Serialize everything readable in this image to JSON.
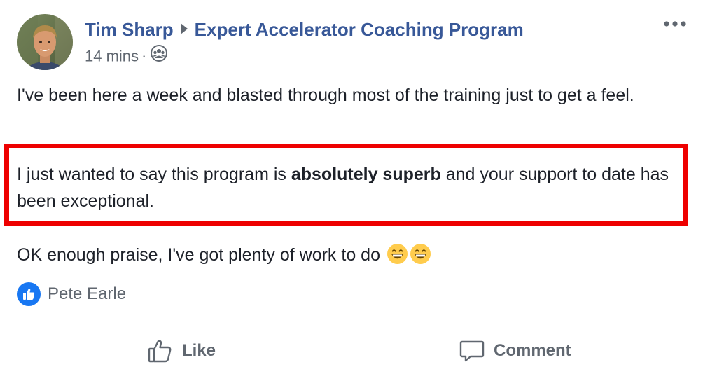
{
  "post": {
    "author": "Tim Sharp",
    "group": "Expert Accelerator Coaching Program",
    "time": "14 mins",
    "separator": "·",
    "audience_icon": "group-icon",
    "more_icon": "more-options-icon",
    "paragraph1": "I've been here a week and blasted through most of the training just to get a feel.",
    "paragraph2_before": "I just wanted to say this program is ",
    "paragraph2_bold": "absolutely superb",
    "paragraph2_after": " and your support to date has been exceptional.",
    "paragraph3": "OK enough praise, I've got plenty of work to do",
    "emojis": [
      "grinning-face-emoji",
      "grinning-face-emoji"
    ],
    "highlight_color": "#ee0000"
  },
  "reactions": {
    "icon": "like-icon",
    "names": "Pete Earle"
  },
  "actions": {
    "like_label": "Like",
    "comment_label": "Comment"
  },
  "colors": {
    "link": "#385898",
    "meta": "#606770",
    "text": "#1d2129",
    "like_blue": "#1877f2"
  }
}
